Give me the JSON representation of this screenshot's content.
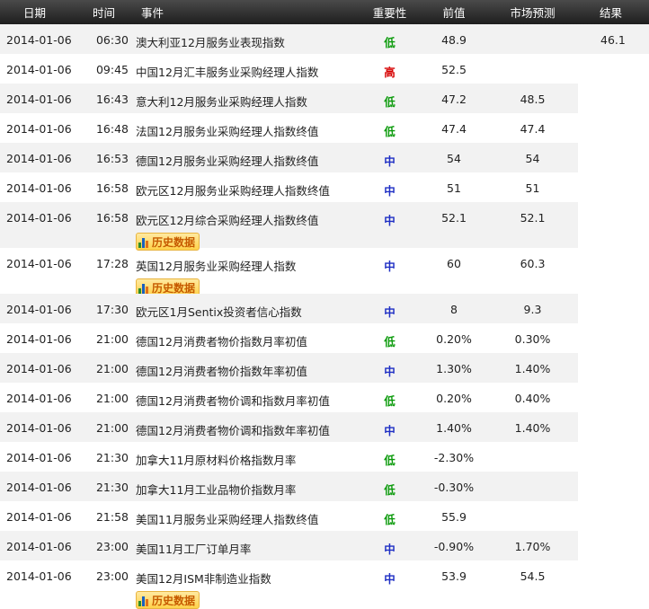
{
  "header": {
    "date": "日期",
    "time": "时间",
    "event": "事件",
    "importance": "重要性",
    "previous": "前值",
    "forecast": "市场预测",
    "result": "结果"
  },
  "history_button_label": "历史数据",
  "importance_colors": {
    "低": "#0a9a0a",
    "中": "#1f2fc4",
    "高": "#d60000"
  },
  "rows": [
    {
      "date": "2014-01-06",
      "time": "06:30",
      "event": "澳大利亚12月服务业表现指数",
      "importance": "低",
      "previous": "48.9",
      "forecast": "",
      "result": "46.1",
      "history": false
    },
    {
      "date": "2014-01-06",
      "time": "09:45",
      "event": "中国12月汇丰服务业采购经理人指数",
      "importance": "高",
      "previous": "52.5",
      "forecast": "",
      "result": "",
      "history": false
    },
    {
      "date": "2014-01-06",
      "time": "16:43",
      "event": "意大利12月服务业采购经理人指数",
      "importance": "低",
      "previous": "47.2",
      "forecast": "48.5",
      "result": "",
      "history": false
    },
    {
      "date": "2014-01-06",
      "time": "16:48",
      "event": "法国12月服务业采购经理人指数终值",
      "importance": "低",
      "previous": "47.4",
      "forecast": "47.4",
      "result": "",
      "history": false
    },
    {
      "date": "2014-01-06",
      "time": "16:53",
      "event": "德国12月服务业采购经理人指数终值",
      "importance": "中",
      "previous": "54",
      "forecast": "54",
      "result": "",
      "history": false
    },
    {
      "date": "2014-01-06",
      "time": "16:58",
      "event": "欧元区12月服务业采购经理人指数终值",
      "importance": "中",
      "previous": "51",
      "forecast": "51",
      "result": "",
      "history": false
    },
    {
      "date": "2014-01-06",
      "time": "16:58",
      "event": "欧元区12月综合采购经理人指数终值",
      "importance": "中",
      "previous": "52.1",
      "forecast": "52.1",
      "result": "",
      "history": true
    },
    {
      "date": "2014-01-06",
      "time": "17:28",
      "event": "英国12月服务业采购经理人指数",
      "importance": "中",
      "previous": "60",
      "forecast": "60.3",
      "result": "",
      "history": true
    },
    {
      "date": "2014-01-06",
      "time": "17:30",
      "event": "欧元区1月Sentix投资者信心指数",
      "importance": "中",
      "previous": "8",
      "forecast": "9.3",
      "result": "",
      "history": false
    },
    {
      "date": "2014-01-06",
      "time": "21:00",
      "event": "德国12月消费者物价指数月率初值",
      "importance": "低",
      "previous": "0.20%",
      "forecast": "0.30%",
      "result": "",
      "history": false
    },
    {
      "date": "2014-01-06",
      "time": "21:00",
      "event": "德国12月消费者物价指数年率初值",
      "importance": "中",
      "previous": "1.30%",
      "forecast": "1.40%",
      "result": "",
      "history": false
    },
    {
      "date": "2014-01-06",
      "time": "21:00",
      "event": "德国12月消费者物价调和指数月率初值",
      "importance": "低",
      "previous": "0.20%",
      "forecast": "0.40%",
      "result": "",
      "history": false
    },
    {
      "date": "2014-01-06",
      "time": "21:00",
      "event": "德国12月消费者物价调和指数年率初值",
      "importance": "中",
      "previous": "1.40%",
      "forecast": "1.40%",
      "result": "",
      "history": false
    },
    {
      "date": "2014-01-06",
      "time": "21:30",
      "event": "加拿大11月原材料价格指数月率",
      "importance": "低",
      "previous": "-2.30%",
      "forecast": "",
      "result": "",
      "history": false
    },
    {
      "date": "2014-01-06",
      "time": "21:30",
      "event": "加拿大11月工业品物价指数月率",
      "importance": "低",
      "previous": "-0.30%",
      "forecast": "",
      "result": "",
      "history": false
    },
    {
      "date": "2014-01-06",
      "time": "21:58",
      "event": "美国11月服务业采购经理人指数终值",
      "importance": "低",
      "previous": "55.9",
      "forecast": "",
      "result": "",
      "history": false
    },
    {
      "date": "2014-01-06",
      "time": "23:00",
      "event": "美国11月工厂订单月率",
      "importance": "中",
      "previous": "-0.90%",
      "forecast": "1.70%",
      "result": "",
      "history": false
    },
    {
      "date": "2014-01-06",
      "time": "23:00",
      "event": "美国12月ISM非制造业指数",
      "importance": "中",
      "previous": "53.9",
      "forecast": "54.5",
      "result": "",
      "history": true
    }
  ]
}
